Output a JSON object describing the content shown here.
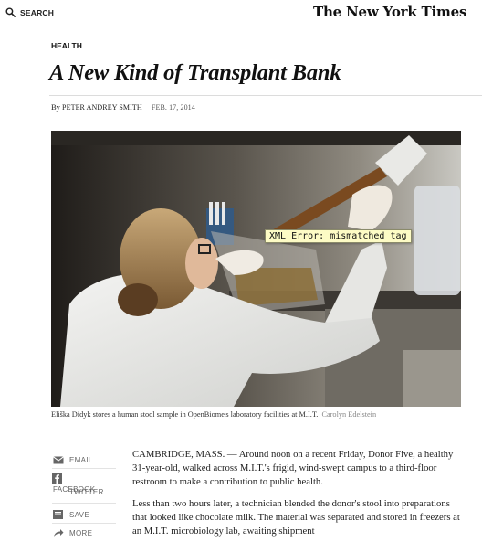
{
  "header": {
    "search_label": "SEARCH",
    "logo_text": "The New York Times"
  },
  "article": {
    "section": "HEALTH",
    "headline": "A New Kind of Transplant Bank",
    "byline_prefix": "By",
    "author": "PETER ANDREY SMITH",
    "date": "FEB. 17, 2014"
  },
  "photo": {
    "caption": "Eliška Didyk stores a human stool sample in OpenBiome's laboratory facilities at M.I.T.",
    "credit": "Carolyn Edelstein",
    "error_tooltip": "XML Error: mismatched tag"
  },
  "share": {
    "email": "EMAIL",
    "facebook": "FACEBOOK",
    "twitter": "TWITTER",
    "save": "SAVE",
    "more": "MORE"
  },
  "body": {
    "paragraph_1": "CAMBRIDGE, MASS. — Around noon on a recent Friday, Donor Five, a healthy 31-year-old, walked across M.I.T.'s frigid, wind-swept campus to a third-floor restroom to make a contribution to public health.",
    "paragraph_2": "Less than two hours later, a technician blended the donor's stool into preparations that looked like chocolate milk. The material was separated and stored in freezers at an M.I.T. microbiology lab, awaiting shipment"
  },
  "colors": {
    "icon_gray": "#666666",
    "divider": "#dcdcdc",
    "tooltip_bg": "#fdfbc5"
  }
}
